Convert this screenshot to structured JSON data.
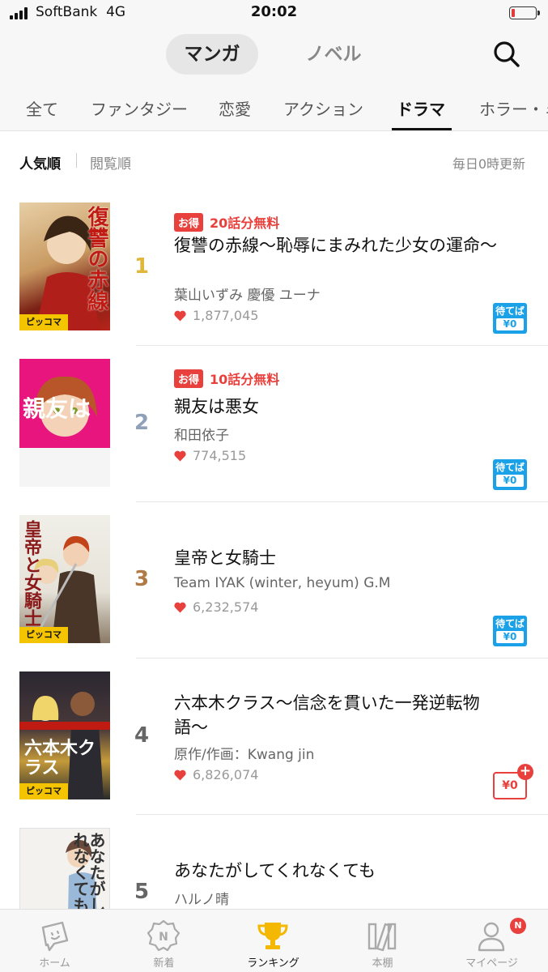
{
  "status_bar": {
    "carrier": "SoftBank",
    "network": "4G",
    "time": "20:02",
    "battery_level": 0.15
  },
  "header": {
    "tabs": [
      {
        "label": "マンガ",
        "active": true
      },
      {
        "label": "ノベル",
        "active": false
      }
    ],
    "search_icon": "search-icon"
  },
  "genres": [
    {
      "label": "全て"
    },
    {
      "label": "ファンタジー"
    },
    {
      "label": "恋愛"
    },
    {
      "label": "アクション"
    },
    {
      "label": "ドラマ",
      "active": true
    },
    {
      "label": "ホラー・ミ"
    }
  ],
  "sort": {
    "popular": "人気順",
    "views": "閲覧順",
    "update_note": "毎日0時更新"
  },
  "rankings": [
    {
      "rank": "1",
      "promo_badge": "お得",
      "promo_text": "20話分無料",
      "title": "復讐の赤線〜恥辱にまみれた少女の運命〜",
      "author": "葉山いずみ 慶優 ユーナ",
      "likes": "1,877,045",
      "badge": {
        "type": "wait",
        "line1": "待てば",
        "line2": "¥0"
      },
      "cover": {
        "title": "復讐の赤線",
        "logo": "ピッコマ"
      }
    },
    {
      "rank": "2",
      "promo_badge": "お得",
      "promo_text": "10話分無料",
      "title": "親友は悪女",
      "author": "和田依子",
      "likes": "774,515",
      "badge": {
        "type": "wait",
        "line1": "待てば",
        "line2": "¥0"
      },
      "cover": {
        "title": "親友は悪女",
        "logo": ""
      }
    },
    {
      "rank": "3",
      "promo_badge": "",
      "promo_text": "",
      "title": "皇帝と女騎士",
      "author": "Team IYAK (winter, heyum) G.M",
      "likes": "6,232,574",
      "badge": {
        "type": "wait",
        "line1": "待てば",
        "line2": "¥0"
      },
      "cover": {
        "title": "皇帝と女騎士",
        "logo": "ピッコマ"
      }
    },
    {
      "rank": "4",
      "promo_badge": "",
      "promo_text": "",
      "title": "六本木クラス〜信念を貫いた一発逆転物語〜",
      "author": "原作/作画：Kwang jin",
      "likes": "6,826,074",
      "badge": {
        "type": "free",
        "label": "¥0",
        "plus": "+"
      },
      "cover": {
        "title": "六本木クラス",
        "logo": "ピッコマ"
      }
    },
    {
      "rank": "5",
      "promo_badge": "",
      "promo_text": "",
      "title": "あなたがしてくれなくても",
      "author": "ハルノ晴",
      "likes": "",
      "badge": null,
      "cover": {
        "title": "あなたがしてくれなくても",
        "logo": ""
      }
    }
  ],
  "bottom_nav": [
    {
      "label": "ホーム",
      "icon": "home-icon"
    },
    {
      "label": "新着",
      "icon": "new-icon",
      "icon_text": "N"
    },
    {
      "label": "ランキング",
      "icon": "trophy-icon",
      "active": true
    },
    {
      "label": "本棚",
      "icon": "bookshelf-icon"
    },
    {
      "label": "マイページ",
      "icon": "user-icon",
      "notification": "N"
    }
  ],
  "colors": {
    "accent_red": "#e8403c",
    "wait_blue": "#1aa1e8",
    "gold": "#f5c400",
    "rank1": "#e0b73a",
    "rank2": "#8fa0b8",
    "rank3": "#b07a45",
    "rank_default": "#666666"
  }
}
